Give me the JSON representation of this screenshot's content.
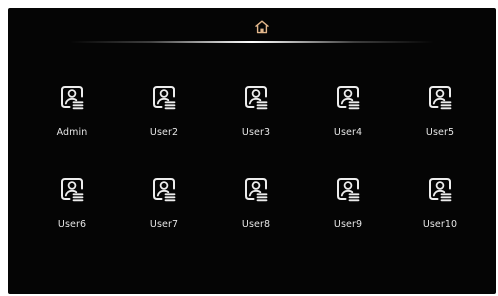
{
  "header": {
    "home_icon": "home-icon",
    "accent_color": "#e0b58a"
  },
  "users": [
    {
      "label": "Admin",
      "icon": "user-card-icon"
    },
    {
      "label": "User2",
      "icon": "user-card-icon"
    },
    {
      "label": "User3",
      "icon": "user-card-icon"
    },
    {
      "label": "User4",
      "icon": "user-card-icon"
    },
    {
      "label": "User5",
      "icon": "user-card-icon"
    },
    {
      "label": "User6",
      "icon": "user-card-icon"
    },
    {
      "label": "User7",
      "icon": "user-card-icon"
    },
    {
      "label": "User8",
      "icon": "user-card-icon"
    },
    {
      "label": "User9",
      "icon": "user-card-icon"
    },
    {
      "label": "User10",
      "icon": "user-card-icon"
    }
  ]
}
